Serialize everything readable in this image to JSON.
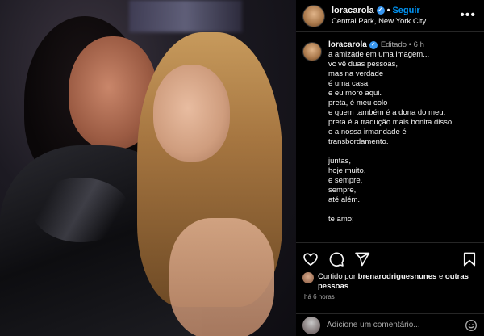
{
  "post": {
    "username": "loracarola",
    "follow_label": "Seguir",
    "location": "Central Park, New York City"
  },
  "caption": {
    "username": "loracarola",
    "edited": "Editado",
    "age": "6 h",
    "lines_a": [
      "a amizade em uma imagem...",
      "vc vê duas pessoas,",
      "mas na verdade",
      "é uma casa,",
      "e eu moro aqui.",
      "preta, é meu colo",
      "e quem também é a dona do meu.",
      "preta é a tradução mais bonita disso;",
      "e a nossa irmandade é",
      "transbordamento."
    ],
    "lines_b": [
      "juntas,",
      "hoje muito,",
      "e sempre,",
      "sempre,",
      "até além."
    ],
    "lines_c": [
      "te amo;"
    ]
  },
  "likes": {
    "prefix": "Curtido por",
    "user": "brenarodriguesnunes",
    "middle": "e",
    "others": "outras pessoas"
  },
  "timestamp": "há 6 horas",
  "comment": {
    "placeholder": "Adicione um comentário..."
  },
  "icons": {
    "like": "heart-icon",
    "comment": "comment-icon",
    "share": "share-icon",
    "save": "bookmark-icon",
    "more": "more-icon",
    "emoji": "emoji-icon",
    "verified": "verified-icon"
  },
  "colors": {
    "background": "#000000",
    "link": "#0095f6",
    "verified": "#3897f0",
    "muted": "#a8a8a8"
  }
}
